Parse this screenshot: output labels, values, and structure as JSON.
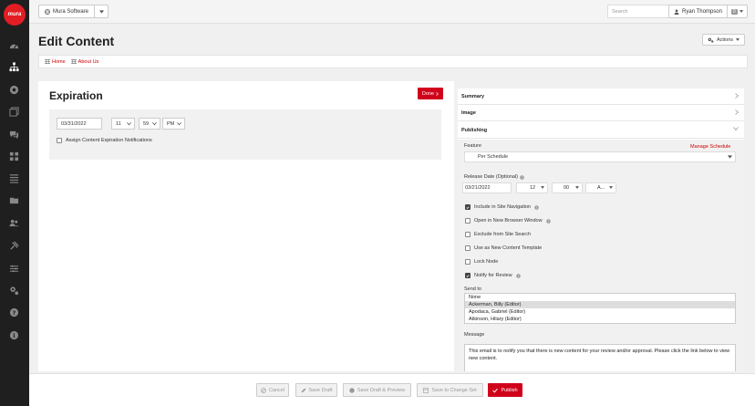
{
  "logo": {
    "text": "mura"
  },
  "topbar": {
    "site_label": "Mura Software",
    "search_placeholder": "Search",
    "user_name": "Ryan Thompson",
    "user_badge": "0"
  },
  "header": {
    "title": "Edit Content",
    "actions_label": "Actions"
  },
  "breadcrumb": [
    {
      "label": "Home"
    },
    {
      "label": "About Us"
    }
  ],
  "expiration": {
    "title": "Expiration",
    "done_label": "Done",
    "date": "03/31/2022",
    "hour": "11",
    "minute": "59",
    "ampm": "PM",
    "notify_label": "Assign Content Expiration Notifications"
  },
  "accordion": {
    "summary": "Summary",
    "image": "Image",
    "publishing": "Publishing"
  },
  "publishing": {
    "feature_label": "Feature",
    "manage_schedule": "Manage Schedule",
    "feature_value": "Per Schedule",
    "release_label": "Release Date (Optional)",
    "release_date": "03/21/2022",
    "release_hour": "12",
    "release_minute": "00",
    "release_ampm": "A...",
    "checkboxes": [
      {
        "label": "Include in Site Navigation",
        "checked": true
      },
      {
        "label": "Open in New Browser Window",
        "checked": false
      },
      {
        "label": "Exclude from Site Search",
        "checked": false
      },
      {
        "label": "Use as New Content Template",
        "checked": false
      },
      {
        "label": "Lock Node",
        "checked": false
      },
      {
        "label": "Notify for Review",
        "checked": true
      }
    ],
    "send_to_label": "Send to",
    "send_to_options": [
      {
        "label": "None"
      },
      {
        "label": "Ackerman, Billy (Editor)"
      },
      {
        "label": "Apodaca, Gabriel (Editor)"
      },
      {
        "label": "Atkinson, Hilary (Editor)"
      }
    ],
    "message_label": "Message",
    "message_value": "This email is to notify you that there is new content for your review and/or approval. Please click the link below to view new content."
  },
  "footer": {
    "cancel": "Cancel",
    "save_draft": "Save Draft",
    "save_draft_preview": "Save Draft & Preview",
    "save_change_set": "Save to Change Set",
    "publish": "Publish"
  },
  "colors": {
    "accent": "#d0021b",
    "sidebar": "#1f1f1f"
  }
}
